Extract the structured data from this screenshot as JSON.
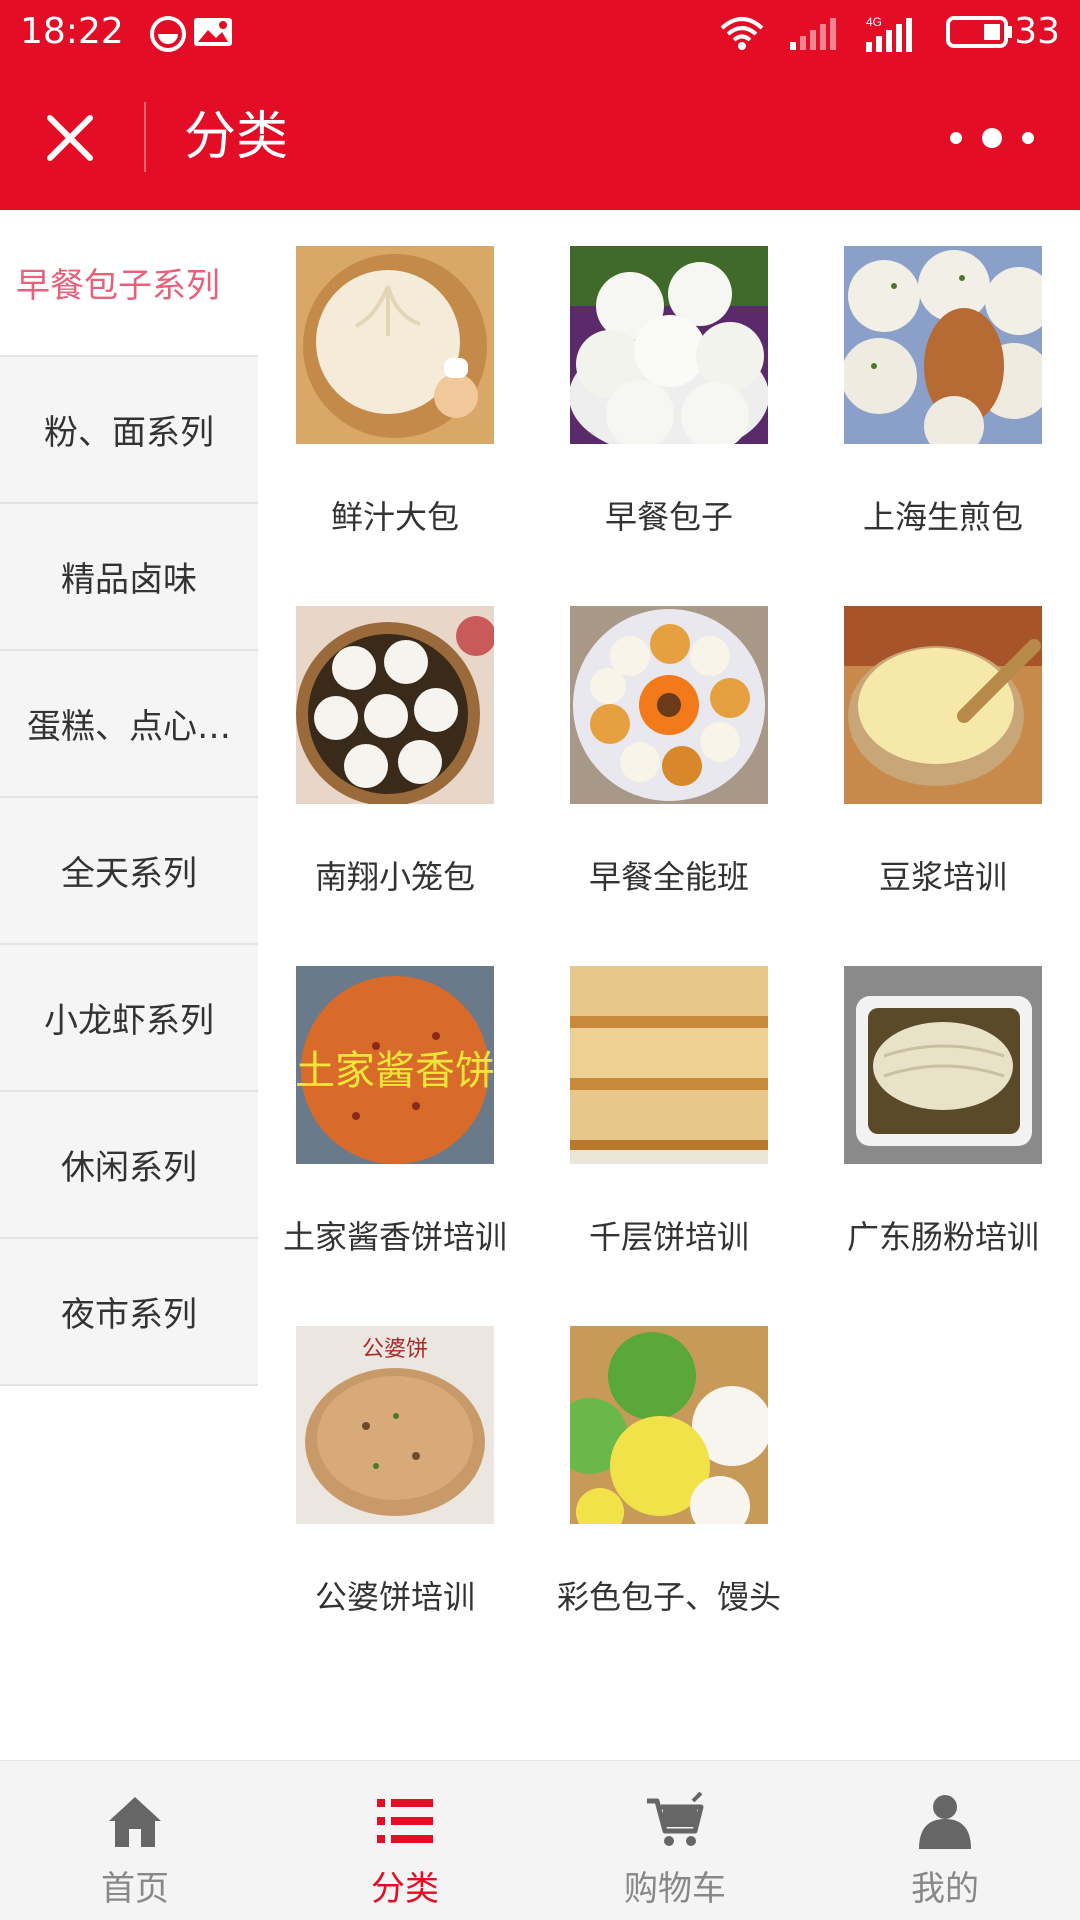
{
  "status_bar": {
    "time": "18:22",
    "network": "4G",
    "battery": "33"
  },
  "header": {
    "title": "分类",
    "close_icon": "close-icon",
    "more_icon": "more-dots-icon"
  },
  "sidebar": {
    "items": [
      {
        "label": "早餐包子系列",
        "active": true
      },
      {
        "label": "粉、面系列",
        "active": false
      },
      {
        "label": "精品卤味",
        "active": false
      },
      {
        "label": "蛋糕、点心…",
        "active": false
      },
      {
        "label": "全天系列",
        "active": false
      },
      {
        "label": "小龙虾系列",
        "active": false
      },
      {
        "label": "休闲系列",
        "active": false
      },
      {
        "label": "夜市系列",
        "active": false
      }
    ]
  },
  "products": [
    {
      "name": "鲜汁大包",
      "image": "steamed-bun-image"
    },
    {
      "name": "早餐包子",
      "image": "buns-plate-image"
    },
    {
      "name": "上海生煎包",
      "image": "pan-fried-bun-image"
    },
    {
      "name": "南翔小笼包",
      "image": "xiaolongbao-steamer-image"
    },
    {
      "name": "早餐全能班",
      "image": "breakfast-platter-image"
    },
    {
      "name": "豆浆培训",
      "image": "soy-milk-bowl-image"
    },
    {
      "name": "土家酱香饼培训",
      "image": "tujia-pancake-image",
      "image_text": "土家酱香饼"
    },
    {
      "name": "千层饼培训",
      "image": "layered-pancake-image"
    },
    {
      "name": "广东肠粉培训",
      "image": "rice-noodle-roll-image"
    },
    {
      "name": "公婆饼培训",
      "image": "gongpo-pancake-image",
      "image_text": "公婆饼"
    },
    {
      "name": "彩色包子、馒头",
      "image": "colorful-buns-image"
    }
  ],
  "tabbar": {
    "tabs": [
      {
        "label": "首页",
        "icon": "home-icon",
        "active": false
      },
      {
        "label": "分类",
        "icon": "list-icon",
        "active": true
      },
      {
        "label": "购物车",
        "icon": "cart-icon",
        "active": false
      },
      {
        "label": "我的",
        "icon": "user-icon",
        "active": false
      }
    ]
  },
  "colors": {
    "brand": "#e30d25",
    "sidebar_active": "#e8607a"
  }
}
